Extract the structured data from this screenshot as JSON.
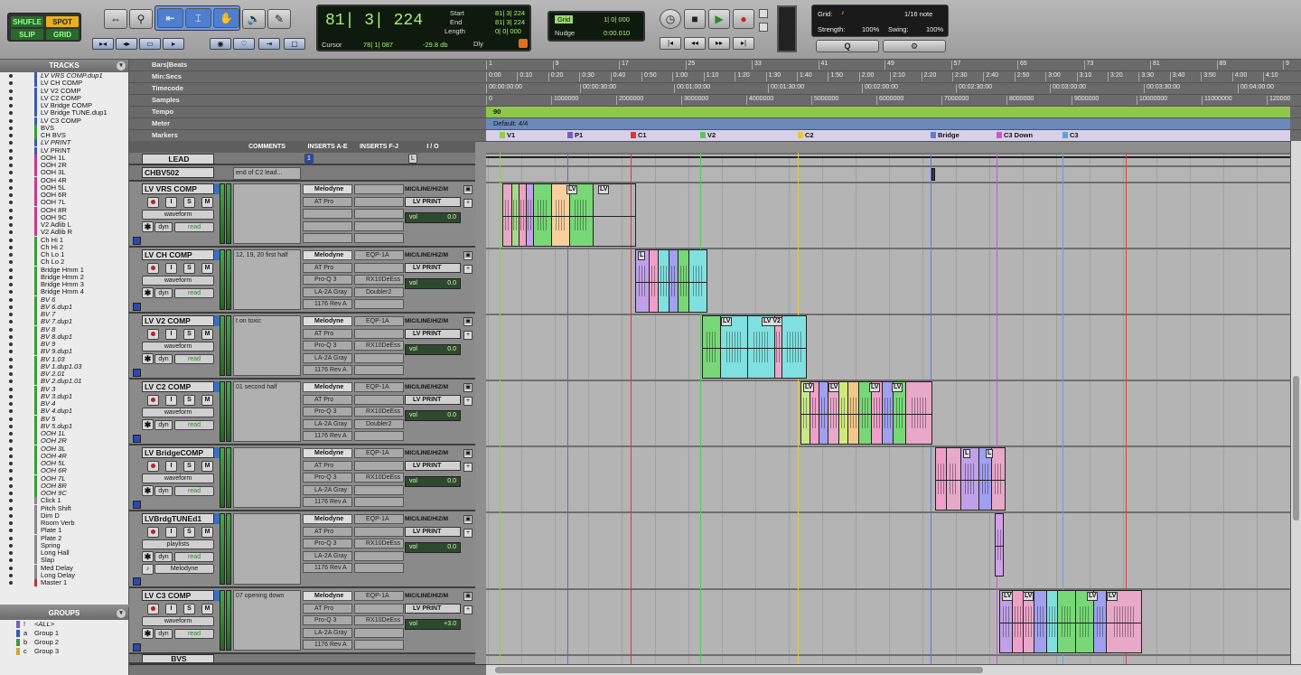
{
  "toolbar": {
    "modes": [
      "SHUFLE",
      "SPOT",
      "SLIP",
      "GRID"
    ],
    "counter": {
      "main": "81| 3| 224",
      "start_label": "Start",
      "end_label": "End",
      "length_label": "Length",
      "start": "81| 3| 224",
      "end": "81| 3| 224",
      "length": "0| 0| 000",
      "cursor_label": "Cursor",
      "cursor": "78| 1| 087",
      "cursor_db": "-29.8 db",
      "dly": "Dly"
    },
    "grid": {
      "label": "Grid",
      "value": "1| 0| 000",
      "nudge_label": "Nudge",
      "nudge": "0:00.010"
    },
    "quantize": {
      "grid_label": "Grid:",
      "note": "1/16 note",
      "strength_label": "Strength:",
      "strength": "100%",
      "swing_label": "Swing:",
      "swing": "100%",
      "q_label": "Q"
    }
  },
  "tracks_panel": {
    "title": "TRACKS",
    "items": [
      {
        "n": "LV VRS COMP.dup1",
        "c": "#3a5aa8",
        "i": true
      },
      {
        "n": "LV CH COMP",
        "c": "#3a5aa8"
      },
      {
        "n": "LV V2 COMP",
        "c": "#3a5aa8"
      },
      {
        "n": "LV C2 COMP",
        "c": "#3a5aa8"
      },
      {
        "n": "LV Bridge COMP",
        "c": "#3a5aa8"
      },
      {
        "n": "LV Bridge TUNE.dup1",
        "c": "#3a5aa8"
      },
      {
        "n": "LV C3 COMP",
        "c": "#3a5aa8"
      },
      {
        "n": "BVS",
        "c": "#3a9a3a"
      },
      {
        "n": "CH BVS",
        "c": "#3a9a3a"
      },
      {
        "n": "LV PRINT",
        "c": "#3a5aa8",
        "i": true
      },
      {
        "n": "LV PRINT",
        "c": "#3a5aa8"
      },
      {
        "n": "OOH 1L",
        "c": "#c83a8a"
      },
      {
        "n": "OOH 2R",
        "c": "#c83a8a"
      },
      {
        "n": "OOH 3L",
        "c": "#c83a8a"
      },
      {
        "n": "OOH 4R",
        "c": "#c83a8a"
      },
      {
        "n": "OOH 5L",
        "c": "#c83a8a"
      },
      {
        "n": "OOH 6R",
        "c": "#c83a8a"
      },
      {
        "n": "OOH 7L",
        "c": "#c83a8a"
      },
      {
        "n": "OOH 8R",
        "c": "#c83a8a"
      },
      {
        "n": "OOH 9C",
        "c": "#c83a8a"
      },
      {
        "n": "V2 Adlib L",
        "c": "#c83a8a"
      },
      {
        "n": "V2 Adlib R",
        "c": "#c83a8a"
      },
      {
        "n": "Ch Hi 1",
        "c": "#3a9a3a"
      },
      {
        "n": "Ch Hi 2",
        "c": "#3a9a3a"
      },
      {
        "n": "Ch Lo 1",
        "c": "#3a9a3a"
      },
      {
        "n": "Ch Lo 2",
        "c": "#3a9a3a"
      },
      {
        "n": "Bridge Hmm 1",
        "c": "#3a9a3a"
      },
      {
        "n": "Bridge Hmm 2",
        "c": "#3a9a3a"
      },
      {
        "n": "Bridge Hmm 3",
        "c": "#3a9a3a"
      },
      {
        "n": "Bridge Hmm 4",
        "c": "#3a9a3a"
      },
      {
        "n": "BV 6",
        "c": "#3a9a3a",
        "i": true
      },
      {
        "n": "BV 6.dup1",
        "c": "#3a9a3a",
        "i": true
      },
      {
        "n": "BV 7",
        "c": "#3a9a3a",
        "i": true
      },
      {
        "n": "BV 7.dup1",
        "c": "#3a9a3a",
        "i": true
      },
      {
        "n": "BV 8",
        "c": "#3a9a3a",
        "i": true
      },
      {
        "n": "BV 8.dup1",
        "c": "#3a9a3a",
        "i": true
      },
      {
        "n": "BV 9",
        "c": "#3a9a3a",
        "i": true
      },
      {
        "n": "BV 9.dup1",
        "c": "#3a9a3a",
        "i": true
      },
      {
        "n": "BV 1.03",
        "c": "#3a9a3a",
        "i": true
      },
      {
        "n": "BV 1.dup1.03",
        "c": "#3a9a3a",
        "i": true
      },
      {
        "n": "BV 2.01",
        "c": "#3a9a3a",
        "i": true
      },
      {
        "n": "BV 2.dup1.01",
        "c": "#3a9a3a",
        "i": true
      },
      {
        "n": "BV 3",
        "c": "#3a9a3a",
        "i": true
      },
      {
        "n": "BV 3.dup1",
        "c": "#3a9a3a",
        "i": true
      },
      {
        "n": "BV 4",
        "c": "#3a9a3a",
        "i": true
      },
      {
        "n": "BV 4.dup1",
        "c": "#3a9a3a",
        "i": true
      },
      {
        "n": "BV 5",
        "c": "#3a9a3a",
        "i": true
      },
      {
        "n": "BV 5.dup1",
        "c": "#3a9a3a",
        "i": true
      },
      {
        "n": "OOH 1L",
        "c": "#3a9a3a",
        "i": true
      },
      {
        "n": "OOH 2R",
        "c": "#3a9a3a",
        "i": true
      },
      {
        "n": "OOH 3L",
        "c": "#3a9a3a",
        "i": true
      },
      {
        "n": "OOH 4R",
        "c": "#3a9a3a",
        "i": true
      },
      {
        "n": "OOH 5L",
        "c": "#3a9a3a",
        "i": true
      },
      {
        "n": "OOH 6R",
        "c": "#3a9a3a",
        "i": true
      },
      {
        "n": "OOH 7L",
        "c": "#3a9a3a",
        "i": true
      },
      {
        "n": "OOH 8R",
        "c": "#3a9a3a",
        "i": true
      },
      {
        "n": "OOH 9C",
        "c": "#3a9a3a",
        "i": true
      },
      {
        "n": "Click 1",
        "c": "#888"
      },
      {
        "n": "Pitch Shift",
        "c": "#888"
      },
      {
        "n": "Dim D",
        "c": "#888"
      },
      {
        "n": "Room Verb",
        "c": "#888"
      },
      {
        "n": "Plate 1",
        "c": "#888"
      },
      {
        "n": "Plate 2",
        "c": "#888"
      },
      {
        "n": "Spring",
        "c": "#888"
      },
      {
        "n": "Long Hall",
        "c": "#888"
      },
      {
        "n": "Slap",
        "c": "#888"
      },
      {
        "n": "Med Delay",
        "c": "#888"
      },
      {
        "n": "Long Delay",
        "c": "#888"
      },
      {
        "n": "Master 1",
        "c": "#c03030"
      }
    ]
  },
  "groups_panel": {
    "title": "GROUPS",
    "items": [
      {
        "id": "!",
        "n": "<ALL>",
        "i": true
      },
      {
        "id": "a",
        "n": "Group 1"
      },
      {
        "id": "b",
        "n": "Group 2"
      },
      {
        "id": "c",
        "n": "Group 3"
      }
    ]
  },
  "mix_header": {
    "comments": "COMMENTS",
    "inserts_ae": "INSERTS A-E",
    "inserts_fj": "INSERTS F-J",
    "io": "I / O"
  },
  "small_tracks": [
    {
      "name": "LEAD",
      "comment": ""
    },
    {
      "name": "CHBV502",
      "comment": "end of C2 lead..."
    }
  ],
  "tracks": [
    {
      "name": "LV VRS COMP",
      "view": "waveform",
      "comment": "",
      "ins_a": [
        "Melodyne",
        "AT Pro",
        "",
        "",
        ""
      ],
      "ins_f": [
        "",
        "",
        "",
        "",
        ""
      ],
      "input": "MIC/LINE/HIZ/M",
      "output": "LV PRINT",
      "vol": "0.0"
    },
    {
      "name": "LV CH COMP",
      "view": "waveform",
      "comment": "12, 19, 20 first half",
      "ins_a": [
        "Melodyne",
        "AT Pro",
        "Pro-Q 3",
        "LA-2A Gray",
        "1176 Rev A"
      ],
      "ins_f": [
        "EQP-1A",
        "",
        "RX10DeEss",
        "Doubler2",
        ""
      ],
      "input": "MIC/LINE/HIZ/M",
      "output": "LV PRINT",
      "vol": "0.0"
    },
    {
      "name": "LV V2 COMP",
      "view": "waveform",
      "comment": "t on toxic",
      "ins_a": [
        "Melodyne",
        "AT Pro",
        "Pro-Q 3",
        "LA-2A Gray",
        "1176 Rev A"
      ],
      "ins_f": [
        "EQP-1A",
        "",
        "RX10DeEss",
        "",
        ""
      ],
      "input": "MIC/LINE/HIZ/M",
      "output": "LV PRINT",
      "vol": "0.0"
    },
    {
      "name": "LV C2 COMP",
      "view": "waveform",
      "comment": "01 second half",
      "ins_a": [
        "Melodyne",
        "AT Pro",
        "Pro-Q 3",
        "LA-2A Gray",
        "1176 Rev A"
      ],
      "ins_f": [
        "EQP-1A",
        "",
        "RX10DeEss",
        "Doubler2",
        ""
      ],
      "input": "MIC/LINE/HIZ/M",
      "output": "LV PRINT",
      "vol": "0.0"
    },
    {
      "name": "LV BridgeCOMP",
      "view": "waveform",
      "comment": "",
      "ins_a": [
        "Melodyne",
        "AT Pro",
        "Pro-Q 3",
        "LA-2A Gray",
        "1176 Rev A"
      ],
      "ins_f": [
        "EQP-1A",
        "",
        "RX10DeEss",
        "",
        ""
      ],
      "input": "MIC/LINE/HIZ/M",
      "output": "LV PRINT",
      "vol": "0.0"
    },
    {
      "name": "LVBrdgTUNEd1",
      "view": "playlists",
      "comment": "",
      "ins_a": [
        "Melodyne",
        "AT Pro",
        "Pro-Q 3",
        "LA-2A Gray",
        "1176 Rev A"
      ],
      "ins_f": [
        "EQP-1A",
        "",
        "RX10DeEss",
        "",
        ""
      ],
      "input": "MIC/LINE/HIZ/M",
      "output": "LV PRINT",
      "vol": "0.0",
      "extra": "Melodyne"
    },
    {
      "name": "LV C3 COMP",
      "view": "waveform",
      "comment": "07 opening down",
      "ins_a": [
        "Melodyne",
        "AT Pro",
        "Pro-Q 3",
        "LA-2A Gray",
        "1176 Rev A"
      ],
      "ins_f": [
        "EQP-1A",
        "",
        "RX10DeEss",
        "",
        ""
      ],
      "input": "MIC/LINE/HIZ/M",
      "output": "LV PRINT",
      "vol": "+3.0"
    }
  ],
  "bottom_track": "BVS",
  "automation": {
    "dyn": "dyn",
    "read": "read"
  },
  "rulers": {
    "labels": [
      "Bars|Beats",
      "Min:Secs",
      "Timecode",
      "Samples",
      "Tempo",
      "Meter",
      "Markers"
    ],
    "bars": [
      "1",
      "9",
      "17",
      "25",
      "33",
      "41",
      "49",
      "57",
      "65",
      "73",
      "81",
      "89",
      "9"
    ],
    "minsecs": [
      "0:00",
      "0:10",
      "0:20",
      "0:30",
      "0:40",
      "0:50",
      "1:00",
      "1:10",
      "1:20",
      "1:30",
      "1:40",
      "1:50",
      "2:00",
      "2:10",
      "2:20",
      "2:30",
      "2:40",
      "2:50",
      "3:00",
      "3:10",
      "3:20",
      "3:30",
      "3:40",
      "3:50",
      "4:00",
      "4:10"
    ],
    "timecode": [
      "00:00:00:00",
      "00:00:30:00",
      "00:01:00:00",
      "00:01:30:00",
      "00:02:00:00",
      "00:02:30:00",
      "00:03:00:00",
      "00:03:30:00",
      "00:04:00:00"
    ],
    "samples": [
      "0",
      "1000000",
      "2000000",
      "3000000",
      "4000000",
      "5000000",
      "6000000",
      "7000000",
      "8000000",
      "9000000",
      "10000000",
      "11000000",
      "120000"
    ],
    "tempo": "90",
    "meter": "Default: 4/4",
    "markers": [
      {
        "n": "V1",
        "c": "#8fd048"
      },
      {
        "n": "P1",
        "c": "#7a5ac8"
      },
      {
        "n": "C1",
        "c": "#d83a3a"
      },
      {
        "n": "V2",
        "c": "#58c858"
      },
      {
        "n": "C2",
        "c": "#e8c838"
      },
      {
        "n": "Bridge",
        "c": "#5a7ad8"
      },
      {
        "n": "C3 Down",
        "c": "#c858c8"
      },
      {
        "n": "C3",
        "c": "#58a8d8"
      }
    ]
  },
  "clip_labels": {
    "lv": "LV",
    "l": "L",
    "lvv2": "LV V2"
  }
}
